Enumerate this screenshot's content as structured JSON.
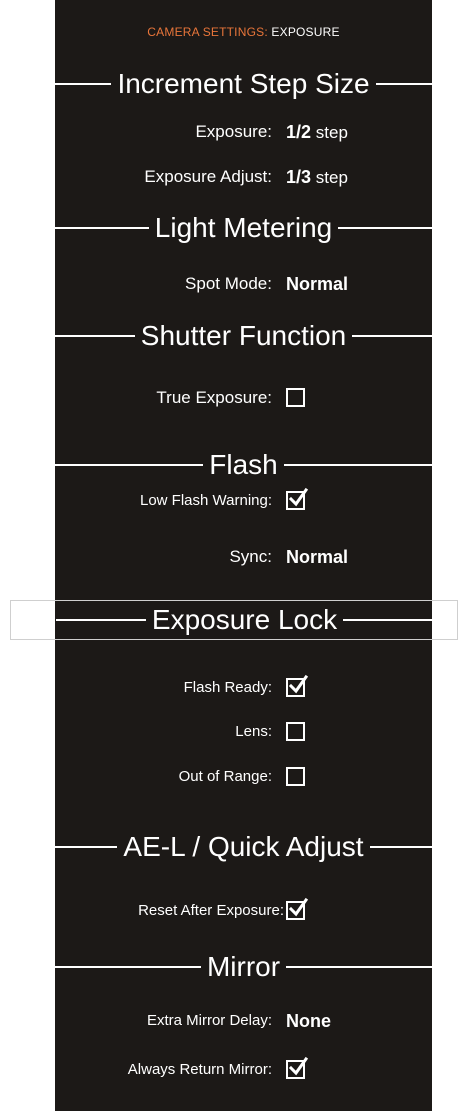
{
  "header": {
    "category": "CAMERA SETTINGS:",
    "page": "EXPOSURE"
  },
  "sections": {
    "increment": "Increment Step Size",
    "metering": "Light Metering",
    "shutter": "Shutter Function",
    "flash": "Flash",
    "exposure_lock": "Exposure Lock",
    "ael": "AE-L / Quick Adjust",
    "mirror": "Mirror"
  },
  "settings": {
    "exposure": {
      "label": "Exposure:",
      "value": "1/2",
      "unit": "step"
    },
    "exposure_adjust": {
      "label": "Exposure Adjust:",
      "value": "1/3",
      "unit": "step"
    },
    "spot_mode": {
      "label": "Spot Mode:",
      "value": "Normal"
    },
    "true_exposure": {
      "label": "True Exposure:",
      "checked": false
    },
    "low_flash_warning": {
      "label": "Low Flash Warning:",
      "checked": true
    },
    "sync": {
      "label": "Sync:",
      "value": "Normal"
    },
    "flash_ready": {
      "label": "Flash Ready:",
      "checked": true
    },
    "lens": {
      "label": "Lens:",
      "checked": false
    },
    "out_of_range": {
      "label": "Out of Range:",
      "checked": false
    },
    "reset_after_exposure": {
      "label": "Reset After Exposure:",
      "checked": true
    },
    "extra_mirror_delay": {
      "label": "Extra Mirror Delay:",
      "value": "None"
    },
    "always_return_mirror": {
      "label": "Always Return Mirror:",
      "checked": true
    }
  },
  "colors": {
    "background": "#1c1917",
    "accent": "#e8753a",
    "text": "#ffffff"
  },
  "icons": {
    "checked": "checkmark-icon",
    "unchecked": "empty-checkbox"
  }
}
